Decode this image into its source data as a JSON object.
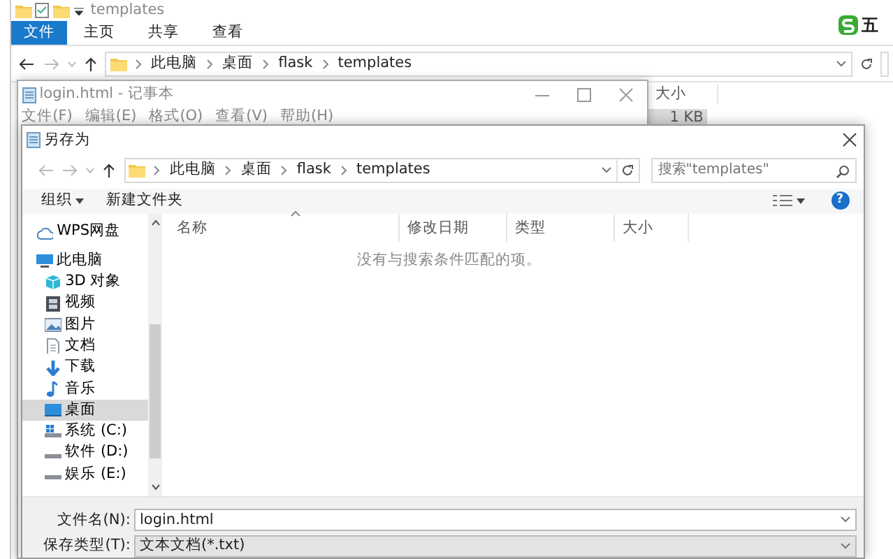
{
  "explorer": {
    "title": "templates",
    "ribbon_tabs": [
      {
        "label": "文件",
        "kind": "file"
      },
      {
        "label": "主页",
        "kind": "tab"
      },
      {
        "label": "共享",
        "kind": "tab"
      },
      {
        "label": "查看",
        "kind": "tab"
      }
    ],
    "breadcrumbs": [
      "此电脑",
      "桌面",
      "flask",
      "templates"
    ],
    "columns": [
      "大小"
    ],
    "rows": [
      {
        "size": "1 KB",
        "selected": true
      }
    ]
  },
  "ime": {
    "mode": "五"
  },
  "notepad": {
    "title": "login.html - 记事本",
    "menu": [
      "文件(F)",
      "编辑(E)",
      "格式(O)",
      "查看(V)",
      "帮助(H)"
    ]
  },
  "save_dialog": {
    "title": "另存为",
    "breadcrumbs": [
      "此电脑",
      "桌面",
      "flask",
      "templates"
    ],
    "search": {
      "placeholder": "搜索\"templates\""
    },
    "toolbar": [
      {
        "label": "组织",
        "kind": "menu"
      },
      {
        "label": "新建文件夹",
        "kind": "plain"
      }
    ],
    "help_button": "?",
    "sidebar": [
      {
        "label": "WPS网盘",
        "kind": "cloud",
        "selected": false
      },
      {
        "label": "此电脑",
        "kind": "pc",
        "selected": false,
        "children": [
          {
            "label": "3D 对象",
            "kind": "cube",
            "selected": false
          },
          {
            "label": "视频",
            "kind": "video",
            "selected": false
          },
          {
            "label": "图片",
            "kind": "image",
            "selected": false
          },
          {
            "label": "文档",
            "kind": "document",
            "selected": false
          },
          {
            "label": "下载",
            "kind": "download",
            "selected": false
          },
          {
            "label": "音乐",
            "kind": "music",
            "selected": false
          },
          {
            "label": "桌面",
            "kind": "desktop",
            "selected": true
          },
          {
            "label": "系统 (C:)",
            "kind": "system-drive",
            "selected": false
          },
          {
            "label": "软件 (D:)",
            "kind": "drive",
            "selected": false
          },
          {
            "label": "娱乐 (E:)",
            "kind": "drive",
            "selected": false
          }
        ]
      }
    ],
    "columns": [
      "名称",
      "修改日期",
      "类型",
      "大小"
    ],
    "empty_message": "没有与搜索条件匹配的项。",
    "file_name": {
      "label": "文件名(N):",
      "value": "login.html"
    },
    "file_type": {
      "label": "保存类型(T):",
      "value": "文本文档(*.txt)"
    }
  }
}
